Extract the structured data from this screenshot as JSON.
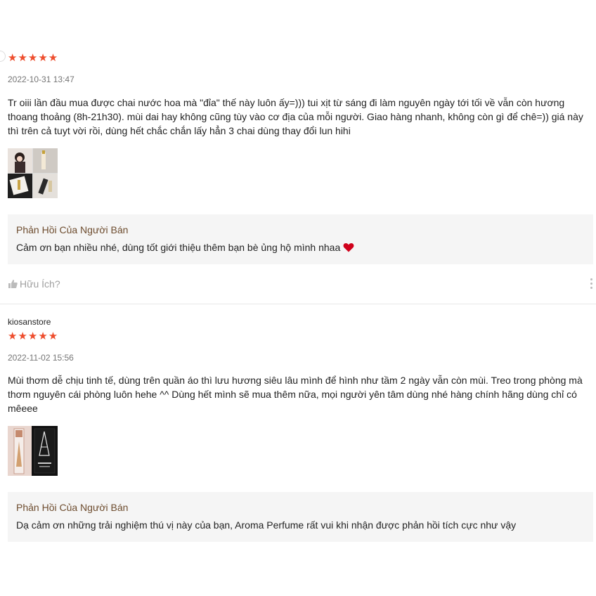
{
  "reviews": [
    {
      "rating_stars": "★★★★★",
      "rating": 5,
      "date": "2022-10-31 13:47",
      "content": "Tr oiii lần đầu mua được chai nước hoa mà \"đỉa\" thế này luôn ấy=))) tui xịt từ sáng đi làm nguyên ngày tới tối về vẫn còn hương thoang thoảng (8h-21h30). mùi dai hay không cũng tùy vào cơ địa của mỗi người. Giao hàng nhanh, không còn gì để chê=)) giá này thì trên cả tuyt vời rồi, dùng hết chắc chắn lấy hẳn 3 chai dùng thay đổi lun hihi",
      "seller_reply_title": "Phản Hồi Của Người Bán",
      "seller_reply_text": "Cảm ơn bạn nhiều nhé, dùng tốt giới thiệu thêm bạn bè ủng hộ mình nhaa",
      "helpful_label": "Hữu Ích?"
    },
    {
      "username": "kiosanstore",
      "rating_stars": "★★★★★",
      "rating": 5,
      "date": "2022-11-02 15:56",
      "content": "Mùi thơm dễ chịu tinh tế, dùng trên quần áo thì lưu hương siêu lâu mình để hình như tầm 2 ngày vẫn còn mùi. Treo trong phòng mà thơm nguyên cái phòng luôn hehe ^^ Dùng hết mình sẽ mua thêm nữa, mọi người yên tâm dùng nhé hàng chính hãng dùng chỉ có mêeee",
      "seller_reply_title": "Phản Hồi Của Người Bán",
      "seller_reply_text": "Dạ cảm ơn những trải nghiệm thú vị này của bạn, Aroma Perfume rất vui khi nhận được phản hồi tích cực như vậy"
    }
  ],
  "colors": {
    "star": "#ee4d2d",
    "reply_bg": "#f5f5f5",
    "reply_title": "#6d4c2e",
    "heart": "#d0011b"
  }
}
